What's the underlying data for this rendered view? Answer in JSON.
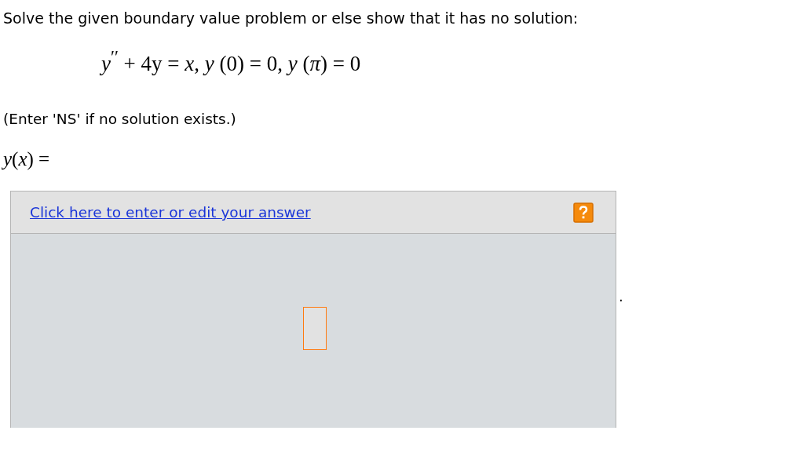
{
  "question": "Solve the given boundary value problem or else show that it has no solution:",
  "equation": "*y*$^{′′}$ + 4y = *x*, *y* (0) = 0, *y* (*π*) = 0",
  "hint": "(Enter 'NS' if no solution exists.)",
  "answer_label": "*y*(*x*) =",
  "answer_panel": {
    "link": "Click here to enter or edit your answer",
    "trailing_mark": "."
  }
}
